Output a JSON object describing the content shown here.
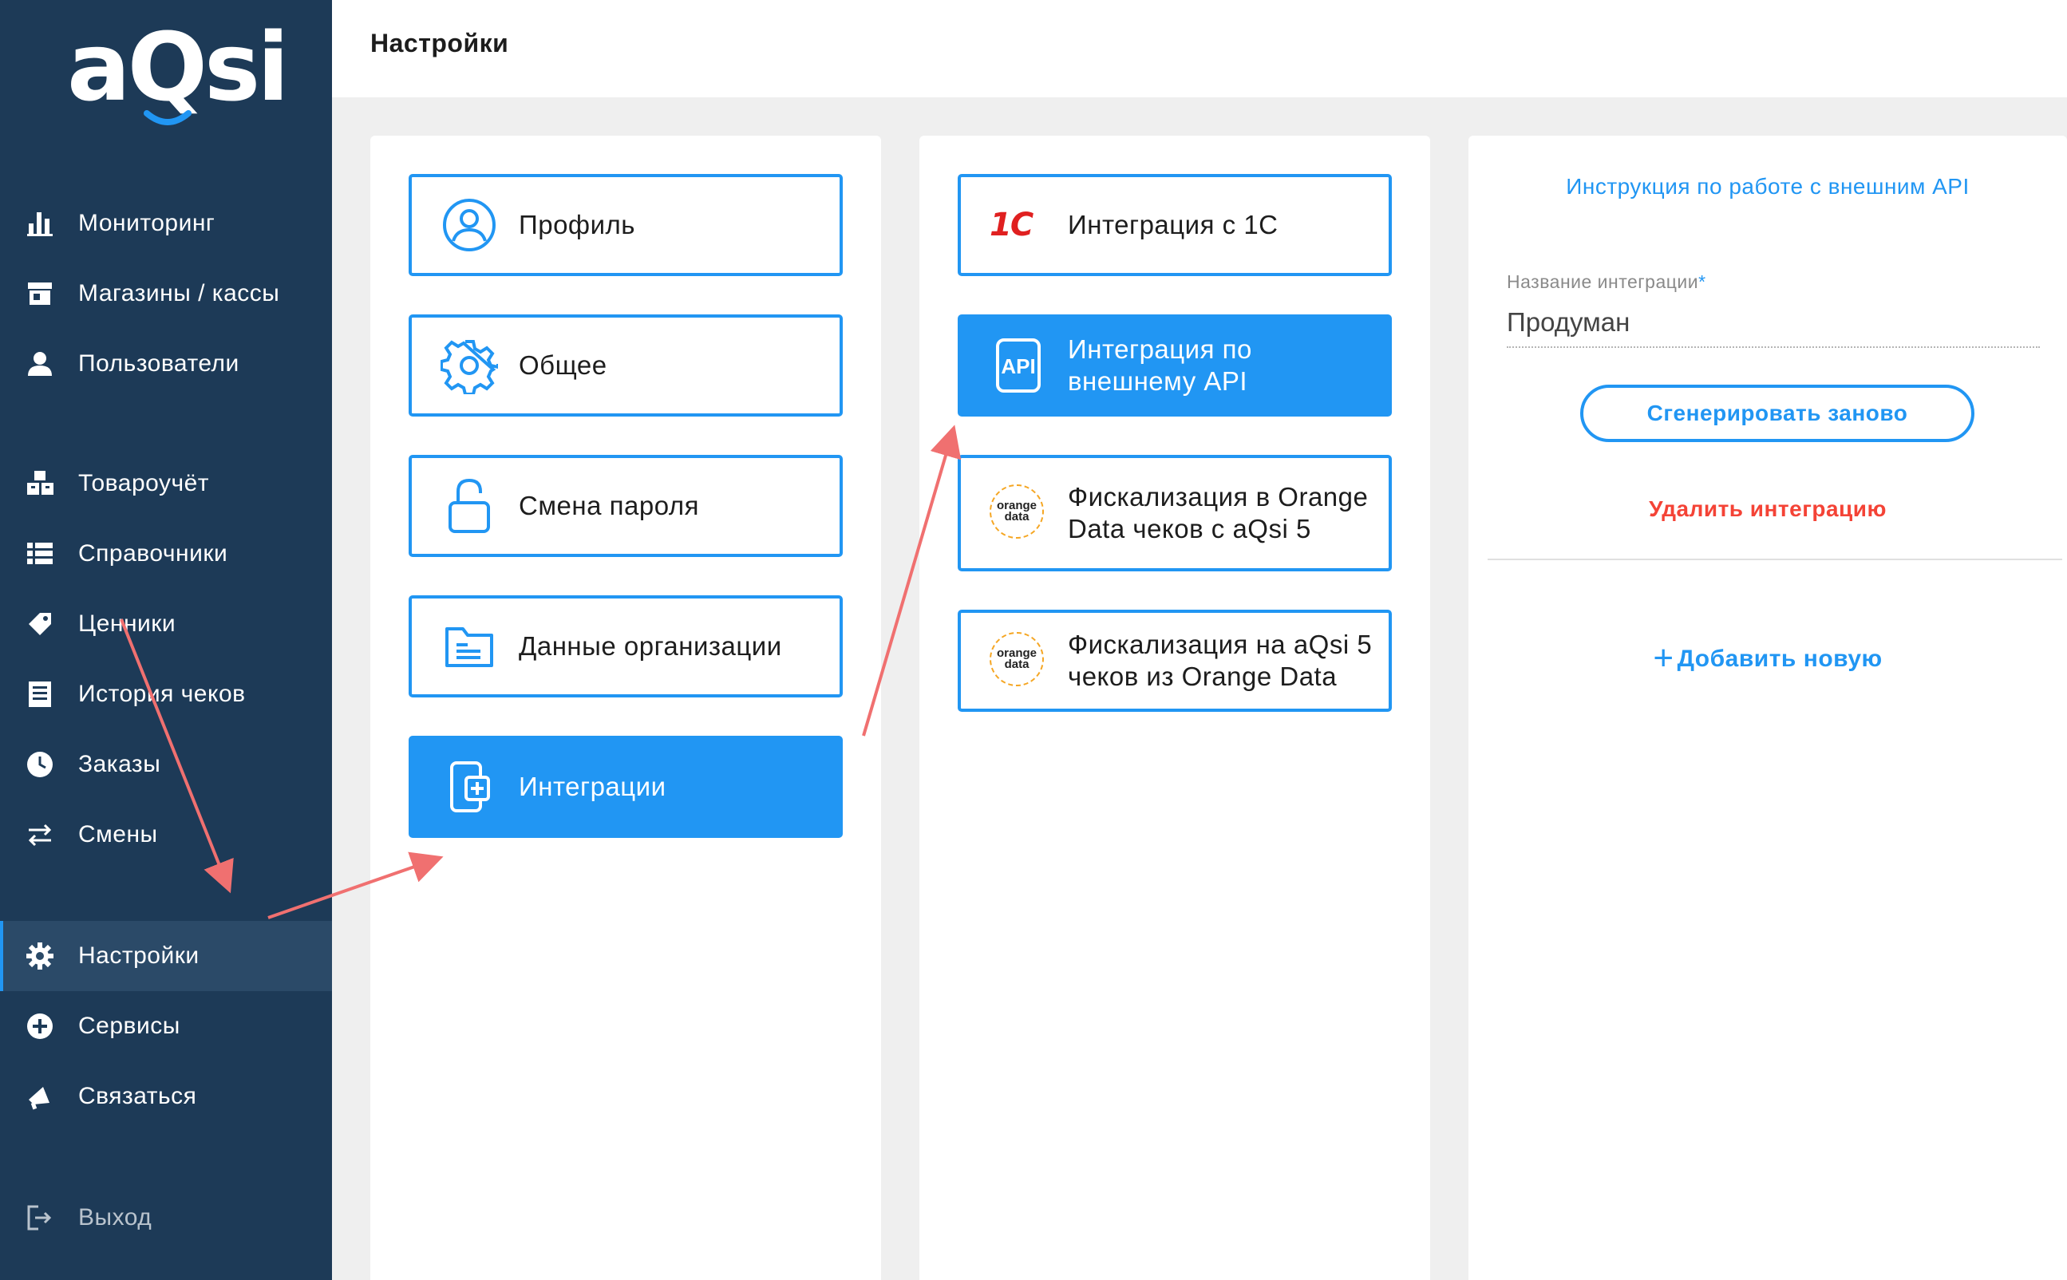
{
  "brand": {
    "logo_text": "aQsi"
  },
  "header": {
    "title": "Настройки"
  },
  "sidebar": {
    "items": [
      {
        "label": "Мониторинг",
        "icon": "bar-chart-icon"
      },
      {
        "label": "Магазины / кассы",
        "icon": "store-icon"
      },
      {
        "label": "Пользователи",
        "icon": "user-icon"
      },
      {
        "label": "Товароучёт",
        "icon": "boxes-icon"
      },
      {
        "label": "Справочники",
        "icon": "list-icon"
      },
      {
        "label": "Ценники",
        "icon": "price-tag-icon"
      },
      {
        "label": "История чеков",
        "icon": "receipt-icon"
      },
      {
        "label": "Заказы",
        "icon": "clock-icon"
      },
      {
        "label": "Смены",
        "icon": "swap-arrows-icon"
      },
      {
        "label": "Настройки",
        "icon": "gear-icon",
        "active": true
      },
      {
        "label": "Сервисы",
        "icon": "plus-circle-icon"
      },
      {
        "label": "Связаться",
        "icon": "megaphone-icon"
      }
    ],
    "logout_label": "Выход"
  },
  "settings_menu": {
    "items": [
      {
        "label": "Профиль",
        "icon": "profile-icon"
      },
      {
        "label": "Общее",
        "icon": "gear-icon"
      },
      {
        "label": "Смена пароля",
        "icon": "unlock-icon"
      },
      {
        "label": "Данные организации",
        "icon": "folder-icon"
      },
      {
        "label": "Интеграции",
        "icon": "integration-icon",
        "active": true
      }
    ]
  },
  "integrations_menu": {
    "items": [
      {
        "label": "Интеграция с 1С",
        "icon": "1c-logo-icon",
        "logo_text": "1С"
      },
      {
        "label": "Интеграция по внешнему API",
        "icon": "api-icon",
        "logo_text": "API",
        "active": true
      },
      {
        "label": "Фискализация в Orange Data чеков с aQsi 5",
        "icon": "orange-data-logo-icon",
        "logo_text": "orange data"
      },
      {
        "label": "Фискализация на aQsi 5 чеков из Orange Data",
        "icon": "orange-data-logo-icon",
        "logo_text": "orange data"
      }
    ]
  },
  "api_panel": {
    "instruction_link": "Инструкция по работе с внешним API",
    "name_label": "Название интеграции",
    "required_mark": "*",
    "name_value": "Продуман",
    "regenerate_label": "Сгенерировать заново",
    "delete_label": "Удалить интеграцию",
    "add_new_icon": "+",
    "add_new_label": "Добавить новую"
  },
  "colors": {
    "sidebar_bg": "#1d3a57",
    "accent": "#2196f3",
    "danger": "#f44336",
    "annotation_arrow": "#f07070"
  }
}
